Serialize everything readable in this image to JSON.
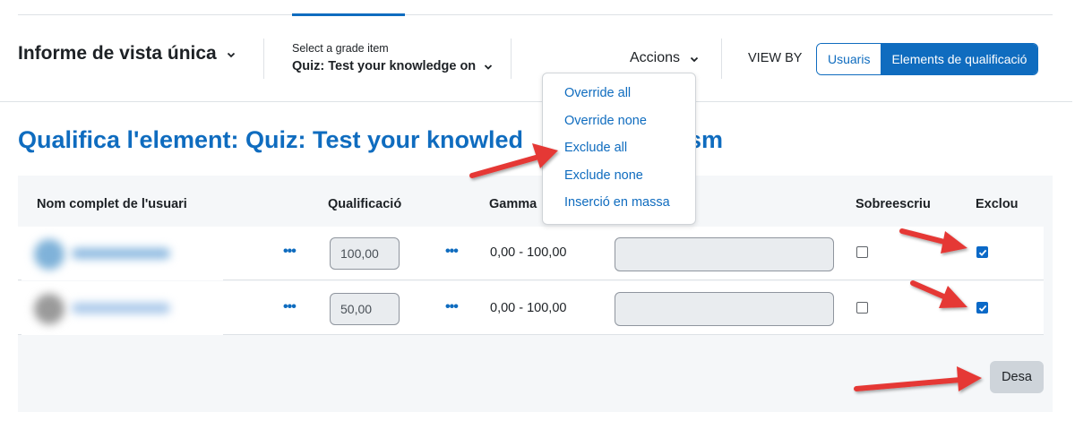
{
  "header": {
    "report_title": "Informe de vista única",
    "grade_item_label": "Select a grade item",
    "grade_item_value": "Quiz: Test your knowledge on",
    "actions_label": "Accions",
    "view_by_label": "VIEW BY",
    "view_by_options": [
      "Usuaris",
      "Elements de qualificació"
    ],
    "view_by_selected": "Elements de qualificació"
  },
  "actions_menu": {
    "items": [
      "Override all",
      "Override none",
      "Exclude all",
      "Exclude none",
      "Inserció en massa"
    ]
  },
  "page_heading": {
    "left": "Qualifica l'element: Quiz: Test your knowled",
    "right": "sm"
  },
  "table": {
    "columns": {
      "name": "Nom complet de l'usuari",
      "grade": "Qualificació",
      "range": "Gamma",
      "override": "Sobreescriu",
      "exclude": "Exclou"
    },
    "rows": [
      {
        "grade": "100,00",
        "range": "0,00 - 100,00",
        "override": false,
        "exclude": true
      },
      {
        "grade": "50,00",
        "range": "0,00 - 100,00",
        "override": false,
        "exclude": true
      }
    ]
  },
  "save_label": "Desa",
  "colors": {
    "accent": "#0f6cbf",
    "annotation_arrow": "#e53935"
  }
}
